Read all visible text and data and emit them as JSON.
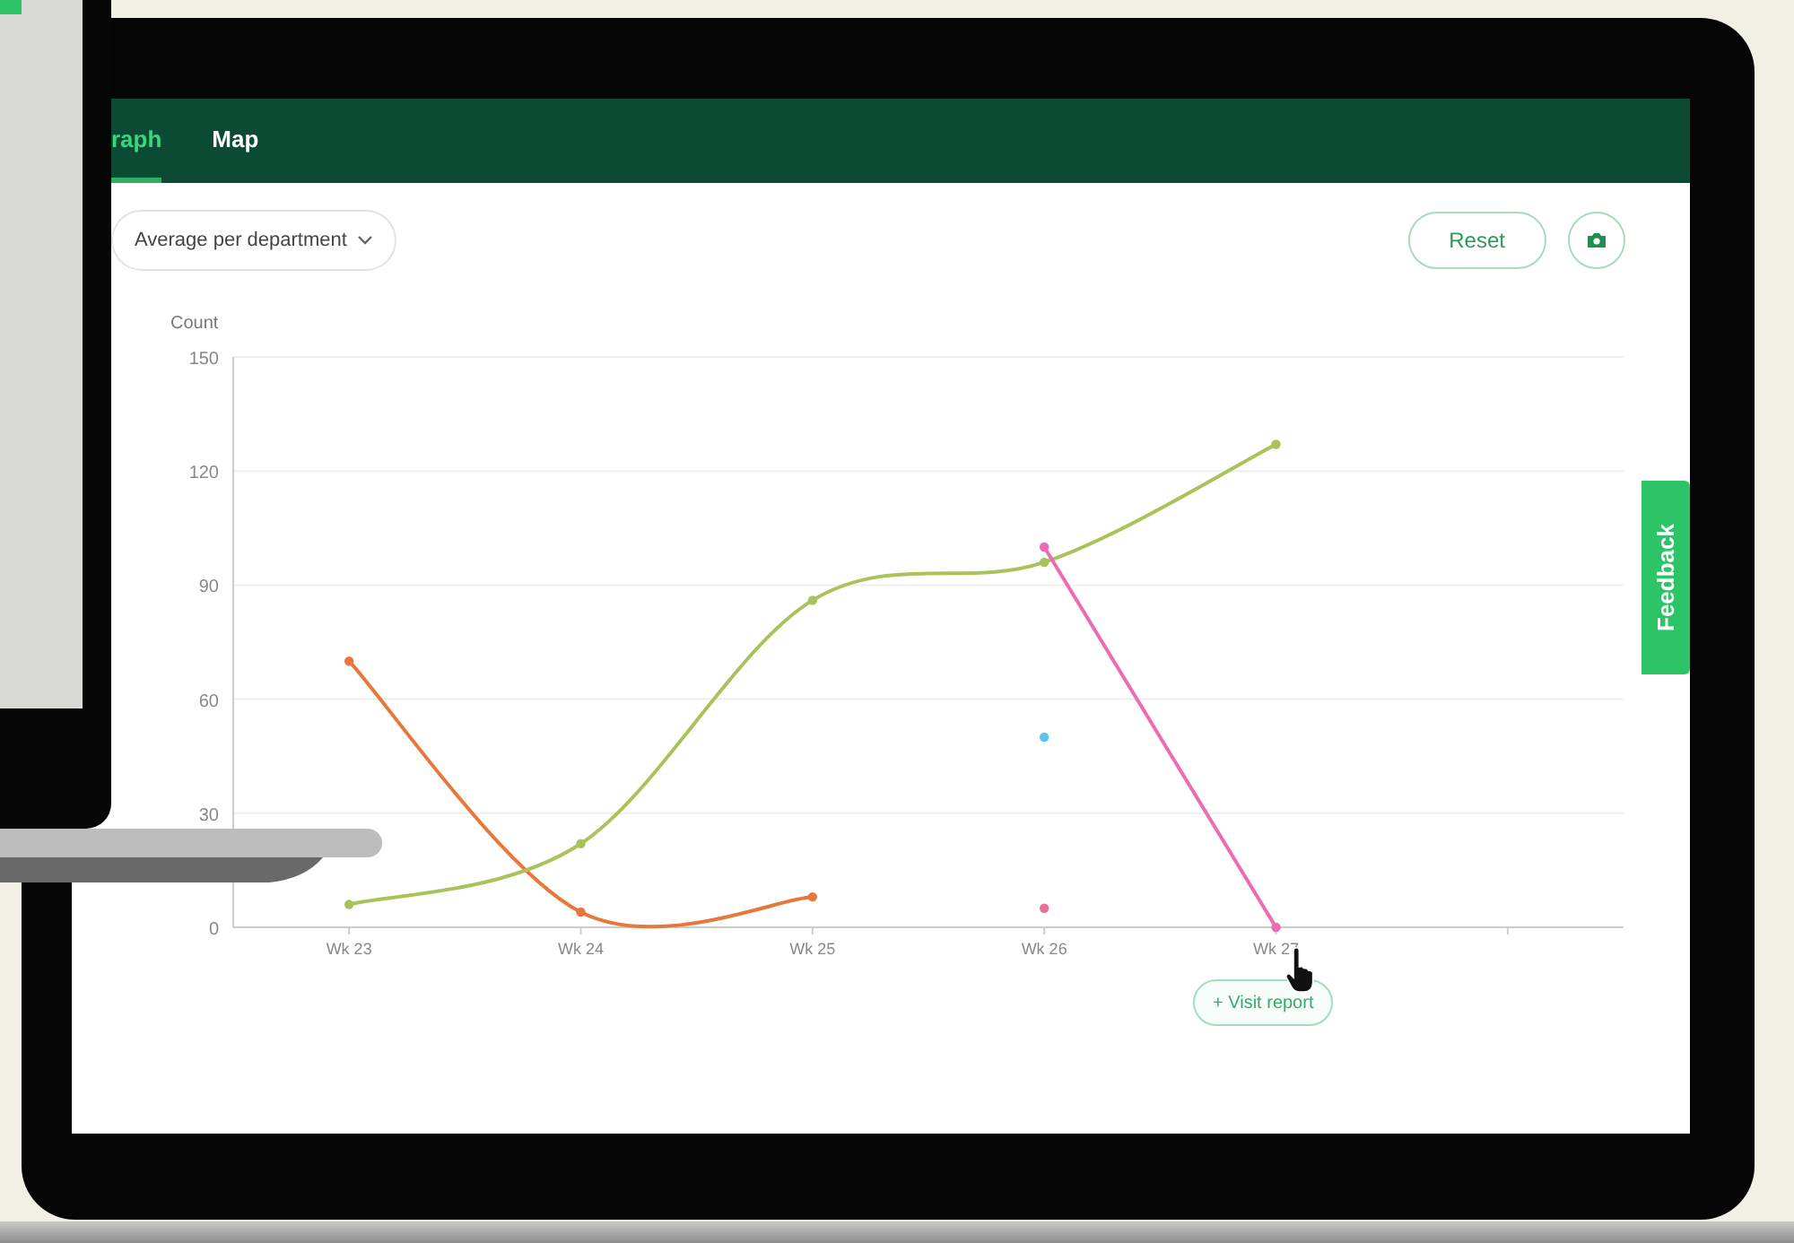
{
  "tabs": [
    {
      "label": "raph",
      "selected": true
    },
    {
      "label": "Map",
      "selected": false
    }
  ],
  "dropdown": {
    "label": "Average per department"
  },
  "reset_button": "Reset",
  "chart": {
    "chart_data": {
      "type": "line",
      "ylabel": "Count",
      "categories": [
        "Wk 23",
        "Wk 24",
        "Wk 25",
        "Wk 26",
        "Wk 27"
      ],
      "ylim": [
        0,
        150
      ],
      "yticks": [
        0,
        30,
        60,
        90,
        120,
        150
      ],
      "grid": true,
      "series": [
        {
          "color": "#e8773a",
          "marker": "circle",
          "values": [
            70,
            4,
            8,
            null,
            null
          ]
        },
        {
          "color": "#a9c25a",
          "marker": "circle",
          "values": [
            6,
            22,
            86,
            96,
            127
          ]
        },
        {
          "color": "#ec6cb4",
          "marker": "circle",
          "values": [
            null,
            null,
            null,
            100,
            0
          ]
        },
        {
          "color": "#5bc3ee",
          "marker": "circle",
          "values": [
            null,
            null,
            null,
            50,
            null
          ]
        },
        {
          "color": "#ee6f95",
          "marker": "circle",
          "values": [
            null,
            null,
            null,
            5,
            null
          ]
        }
      ]
    }
  },
  "visit_button": "+ Visit report",
  "feedback_tab": "Feedback"
}
